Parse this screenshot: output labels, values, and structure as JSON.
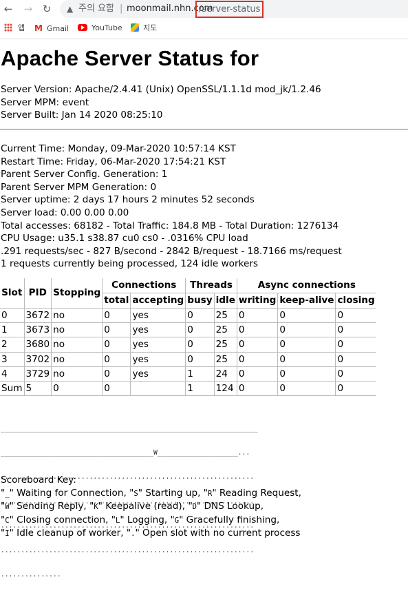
{
  "browser": {
    "security_label": "주의 요함",
    "separator": "|",
    "host": "moonmail.nhn.com",
    "path": "/server-status",
    "bookmarks": [
      {
        "label": "앱",
        "icon": "apps-icon"
      },
      {
        "label": "Gmail",
        "icon": "gmail-icon"
      },
      {
        "label": "YouTube",
        "icon": "youtube-icon"
      },
      {
        "label": "지도",
        "icon": "maps-icon"
      }
    ]
  },
  "page": {
    "title": "Apache Server Status for",
    "server_info": [
      "Server Version: Apache/2.4.41 (Unix) OpenSSL/1.1.1d mod_jk/1.2.46",
      "Server MPM: event",
      "Server Built: Jan 14 2020 08:25:10"
    ],
    "stats": [
      "Current Time: Monday, 09-Mar-2020 10:57:14 KST",
      "Restart Time: Friday, 06-Mar-2020 17:54:21 KST",
      "Parent Server Config. Generation: 1",
      "Parent Server MPM Generation: 0",
      "Server uptime: 2 days 17 hours 2 minutes 52 seconds",
      "Server load: 0.00 0.00 0.00",
      "Total accesses: 68182 - Total Traffic: 184.8 MB - Total Duration: 1276134",
      "CPU Usage: u35.1 s38.87 cu0 cs0 - .0316% CPU load",
      ".291 requests/sec - 827 B/second - 2842 B/request - 18.7166 ms/request",
      "1 requests currently being processed, 124 idle workers"
    ],
    "table": {
      "group_headers": {
        "slot": "Slot",
        "pid": "PID",
        "stopping": "Stopping",
        "connections": "Connections",
        "threads": "Threads",
        "async": "Async connections"
      },
      "sub_headers": [
        "total",
        "accepting",
        "busy",
        "idle",
        "writing",
        "keep-alive",
        "closing"
      ],
      "rows": [
        [
          "0",
          "3672",
          "no",
          "0",
          "yes",
          "0",
          "25",
          "0",
          "0",
          "0"
        ],
        [
          "1",
          "3673",
          "no",
          "0",
          "yes",
          "0",
          "25",
          "0",
          "0",
          "0"
        ],
        [
          "2",
          "3680",
          "no",
          "0",
          "yes",
          "0",
          "25",
          "0",
          "0",
          "0"
        ],
        [
          "3",
          "3702",
          "no",
          "0",
          "yes",
          "0",
          "25",
          "0",
          "0",
          "0"
        ],
        [
          "4",
          "3729",
          "no",
          "0",
          "yes",
          "1",
          "24",
          "0",
          "0",
          "0"
        ],
        [
          "Sum",
          "5",
          "0",
          "0",
          "",
          "1",
          "124",
          "0",
          "0",
          "0"
        ]
      ]
    },
    "scoreboard_lines": [
      "________________________________________________________________",
      "______________________________________W____________________...",
      "...............................................................",
      "...............................................................",
      "...............................................................",
      "...............................................................",
      "..............."
    ],
    "scoreboard_key_title": "Scoreboard Key:",
    "scoreboard_key": [
      [
        [
          "_",
          " Waiting for Connection, "
        ],
        [
          "S",
          " Starting up, "
        ],
        [
          "R",
          " Reading Request,"
        ]
      ],
      [
        [
          "W",
          " Sending Reply, "
        ],
        [
          "K",
          " Keepalive (read), "
        ],
        [
          "D",
          " DNS Lookup,"
        ]
      ],
      [
        [
          "C",
          " Closing connection, "
        ],
        [
          "L",
          " Logging, "
        ],
        [
          "G",
          " Gracefully finishing,"
        ]
      ],
      [
        [
          "I",
          " Idle cleanup of worker, "
        ],
        [
          ".",
          " Open slot with no current process"
        ]
      ]
    ]
  }
}
